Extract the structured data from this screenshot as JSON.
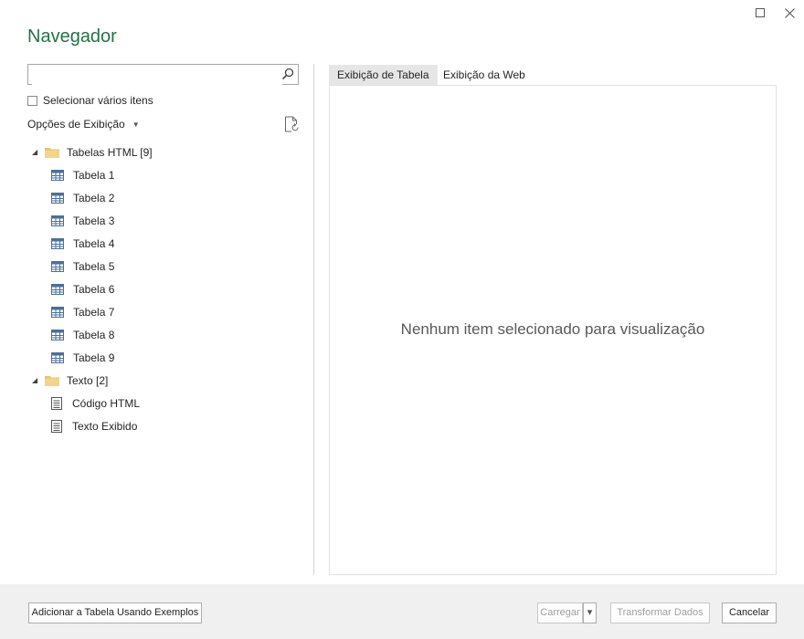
{
  "window": {
    "maximize_glyph": "☐",
    "close_glyph": "✕"
  },
  "title": "Navegador",
  "search": {
    "value": "",
    "placeholder": ""
  },
  "select_multiple": {
    "label": "Selecionar vários itens",
    "checked": false
  },
  "display_options": {
    "label": "Opções de Exibição",
    "caret": "▼"
  },
  "tree": {
    "groups": [
      {
        "label": "Tabelas HTML [9]",
        "icon": "folder-icon",
        "items": [
          {
            "label": "Tabela 1",
            "icon": "table-icon"
          },
          {
            "label": "Tabela 2",
            "icon": "table-icon"
          },
          {
            "label": "Tabela 3",
            "icon": "table-icon"
          },
          {
            "label": "Tabela 4",
            "icon": "table-icon"
          },
          {
            "label": "Tabela 5",
            "icon": "table-icon"
          },
          {
            "label": "Tabela 6",
            "icon": "table-icon"
          },
          {
            "label": "Tabela 7",
            "icon": "table-icon"
          },
          {
            "label": "Tabela 8",
            "icon": "table-icon"
          },
          {
            "label": "Tabela 9",
            "icon": "table-icon"
          }
        ]
      },
      {
        "label": "Texto [2]",
        "icon": "folder-icon",
        "items": [
          {
            "label": "Código HTML",
            "icon": "text-document-icon"
          },
          {
            "label": "Texto Exibido",
            "icon": "text-document-icon"
          }
        ]
      }
    ]
  },
  "tabs": [
    {
      "label": "Exibição de Tabela",
      "active": true
    },
    {
      "label": "Exibição da Web",
      "active": false
    }
  ],
  "preview": {
    "empty_message": "Nenhum item selecionado para visualização"
  },
  "footer": {
    "add_table_button": "Adicionar a Tabela Usando Exemplos",
    "load_button": "Carregar",
    "load_dropdown_glyph": "▾",
    "transform_button": "Transformar Dados",
    "cancel_button": "Cancelar"
  },
  "colors": {
    "title": "#217346",
    "folder": "#e8c36a",
    "table_icon": "#4a6f9c",
    "footer_bg": "#f0f0f0"
  }
}
